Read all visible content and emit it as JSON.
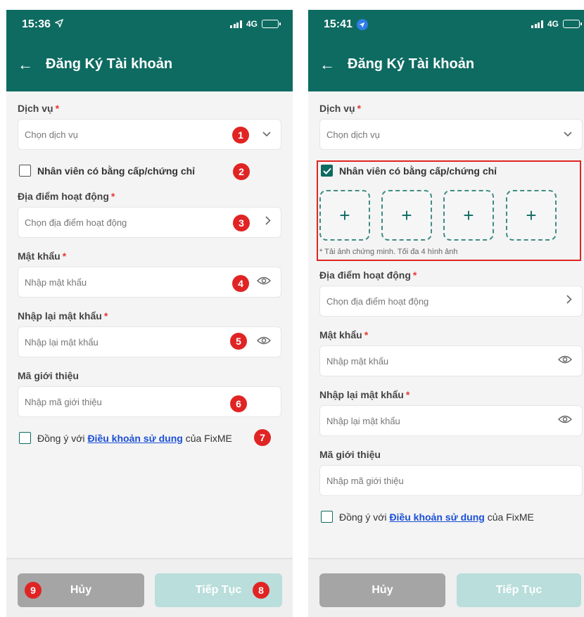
{
  "left": {
    "status": {
      "time": "15:36",
      "network": "4G"
    },
    "header": {
      "title": "Đăng Ký Tài khoản"
    },
    "service": {
      "label": "Dịch vụ",
      "placeholder": "Chọn dịch vụ"
    },
    "certified": {
      "label": "Nhân viên có bằng cấp/chứng chỉ",
      "checked": false
    },
    "location": {
      "label": "Địa điểm hoạt động",
      "placeholder": "Chọn địa điểm hoạt động"
    },
    "password": {
      "label": "Mật khẩu",
      "placeholder": "Nhập mật khẩu"
    },
    "confirm_password": {
      "label": "Nhập lại mật khẩu",
      "placeholder": "Nhập lại mật khẩu"
    },
    "referral": {
      "label": "Mã giới thiệu",
      "placeholder": "Nhập mã giới thiệu"
    },
    "terms": {
      "prefix": "Đồng ý với",
      "link": "Điều khoản sử dung",
      "suffix": "của FixME",
      "checked": false
    },
    "buttons": {
      "cancel": "Hủy",
      "next": "Tiếp Tục"
    },
    "badges": [
      "1",
      "2",
      "3",
      "4",
      "5",
      "6",
      "7",
      "8",
      "9"
    ]
  },
  "right": {
    "status": {
      "time": "15:41",
      "network": "4G"
    },
    "header": {
      "title": "Đăng Ký Tài khoản"
    },
    "service": {
      "label": "Dịch vụ",
      "placeholder": "Chọn dịch vụ"
    },
    "certified": {
      "label": "Nhân viên có bằng cấp/chứng chỉ",
      "checked": true
    },
    "upload": {
      "slots": [
        "+",
        "+",
        "+",
        "+"
      ],
      "hint": "* Tải ảnh chứng minh. Tối đa 4 hình ảnh"
    },
    "location": {
      "label": "Địa điểm hoạt động",
      "placeholder": "Chọn địa điểm hoạt động"
    },
    "password": {
      "label": "Mật khẩu",
      "placeholder": "Nhập mật khẩu"
    },
    "confirm_password": {
      "label": "Nhập lại mật khẩu",
      "placeholder": "Nhập lại mật khẩu"
    },
    "referral": {
      "label": "Mã giới thiệu",
      "placeholder": "Nhập mã giới thiệu"
    },
    "terms": {
      "prefix": "Đồng ý với",
      "link": "Điều khoản sử dung",
      "suffix": "của FixME",
      "checked": false
    },
    "buttons": {
      "cancel": "Hủy",
      "next": "Tiếp Tục"
    }
  },
  "colors": {
    "brand": "#0e6b61",
    "badge": "#e02424",
    "link": "#1a4fd6",
    "cancel": "#a5a5a5",
    "next_disabled": "#b9dedb"
  },
  "icons": [
    "back-arrow-icon",
    "location-arrow-icon",
    "signal-icon",
    "battery-charging-icon",
    "chevron-down-icon",
    "chevron-right-icon",
    "eye-icon",
    "checkmark-icon",
    "plus-icon"
  ]
}
